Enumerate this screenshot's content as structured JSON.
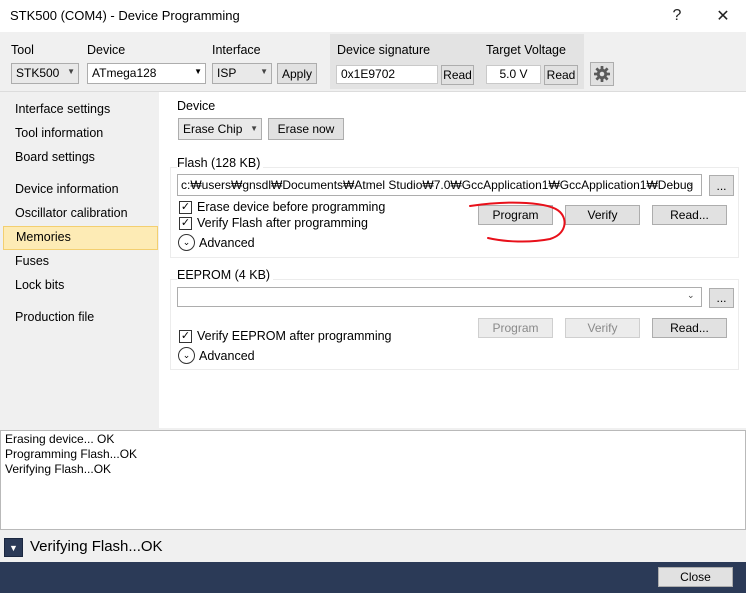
{
  "window": {
    "title": "STK500 (COM4) - Device Programming",
    "help_glyph": "?",
    "close_glyph": "✕"
  },
  "toolbar": {
    "tool_label": "Tool",
    "tool_value": "STK500",
    "device_label": "Device",
    "device_value": "ATmega128",
    "interface_label": "Interface",
    "interface_value": "ISP",
    "apply_label": "Apply",
    "signature_label": "Device signature",
    "signature_value": "0x1E9702",
    "signature_read_label": "Read",
    "voltage_label": "Target Voltage",
    "voltage_value": "5.0 V",
    "voltage_read_label": "Read",
    "settings_icon": "gear-icon"
  },
  "sidebar": {
    "items": [
      {
        "label": "Interface settings"
      },
      {
        "label": "Tool information"
      },
      {
        "label": "Board settings"
      },
      {
        "label": "Device information"
      },
      {
        "label": "Oscillator calibration"
      },
      {
        "label": "Memories",
        "selected": true
      },
      {
        "label": "Fuses"
      },
      {
        "label": "Lock bits"
      },
      {
        "label": "Production file"
      }
    ]
  },
  "device_section": {
    "title": "Device",
    "erase_mode": "Erase Chip",
    "erase_now_label": "Erase now"
  },
  "flash_section": {
    "title": "Flash (128 KB)",
    "file_path": "c:₩users₩gnsdl₩Documents₩Atmel Studio₩7.0₩GccApplication1₩GccApplication1₩Debug",
    "browse_label": "...",
    "erase_before_label": "Erase device before programming",
    "erase_before_checked": true,
    "verify_after_label": "Verify Flash after programming",
    "verify_after_checked": true,
    "advanced_label": "Advanced",
    "program_label": "Program",
    "verify_label": "Verify",
    "read_label": "Read..."
  },
  "eeprom_section": {
    "title": "EEPROM (4 KB)",
    "file_path": "",
    "browse_label": "...",
    "verify_after_label": "Verify EEPROM after programming",
    "verify_after_checked": true,
    "advanced_label": "Advanced",
    "program_label": "Program",
    "verify_label": "Verify",
    "read_label": "Read..."
  },
  "log": {
    "lines": [
      "Erasing device... OK",
      "Programming Flash...OK",
      "Verifying Flash...OK"
    ]
  },
  "status": {
    "text": "Verifying Flash...OK"
  },
  "footer": {
    "close_label": "Close"
  },
  "colors": {
    "selected_bg": "#fdebb5",
    "annotation": "#e8101a",
    "footer_bg": "#2b3a57"
  }
}
